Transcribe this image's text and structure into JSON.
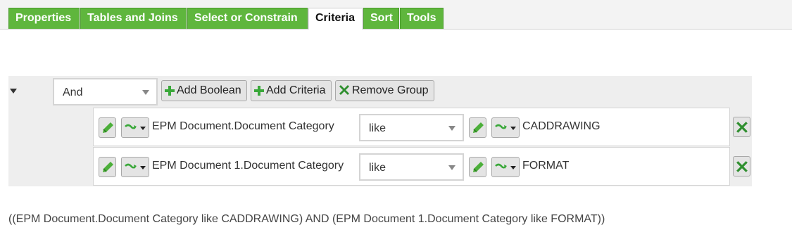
{
  "tabs": [
    {
      "label": "Properties",
      "active": false
    },
    {
      "label": "Tables and Joins",
      "active": false
    },
    {
      "label": "Select or Constrain",
      "active": false
    },
    {
      "label": "Criteria",
      "active": true
    },
    {
      "label": "Sort",
      "active": false
    },
    {
      "label": "Tools",
      "active": false
    }
  ],
  "group": {
    "operator": "And",
    "add_boolean_label": "Add Boolean",
    "add_criteria_label": "Add Criteria",
    "remove_group_label": "Remove Group"
  },
  "criteria": [
    {
      "attribute": "EPM Document.Document Category",
      "operator": "like",
      "value": "CADDRAWING"
    },
    {
      "attribute": "EPM Document 1.Document Category",
      "operator": "like",
      "value": "FORMAT"
    }
  ],
  "summary": "((EPM Document.Document Category like CADDRAWING) AND (EPM Document 1.Document Category like FORMAT))",
  "colors": {
    "accent": "#5fb63d",
    "remove": "#2f8f2f"
  }
}
